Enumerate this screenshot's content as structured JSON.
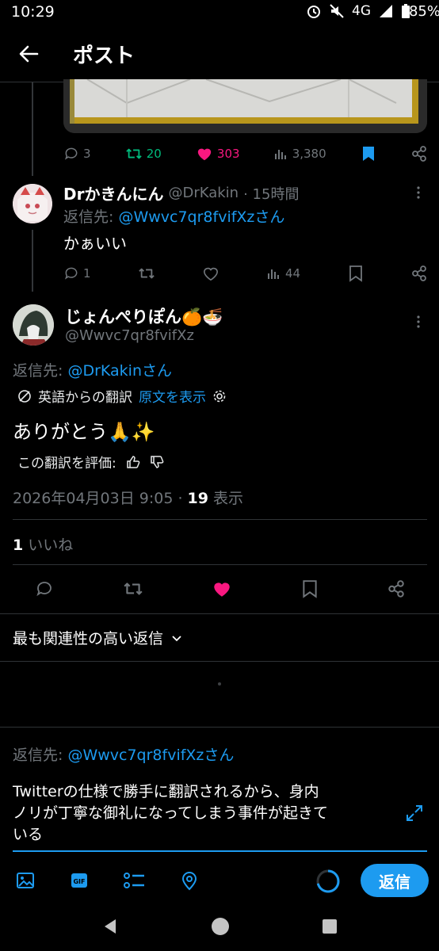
{
  "status_bar": {
    "time": "10:29",
    "network": "4G",
    "battery": "85%"
  },
  "header": {
    "title": "ポスト"
  },
  "prev_post": {
    "replies": "3",
    "retweets": "20",
    "likes": "303",
    "views": "3,380"
  },
  "reply1": {
    "display_name": "Drかきんにん",
    "handle": "@DrKakin",
    "time": "· 15時間",
    "reply_to_prefix": "返信先: ",
    "reply_to_handle": "@Wwvc7qr8fvifXzさん",
    "text": "かぁいい",
    "replies": "1",
    "views": "44"
  },
  "main_post": {
    "display_name": "じょんぺりぽん🍊🍜",
    "handle": "@Wwvc7qr8fvifXz",
    "reply_to_prefix": "返信先: ",
    "reply_to_handle": "@DrKakinさん",
    "translated_from": "英語からの翻訳",
    "show_original": "原文を表示",
    "text": "ありがとう🙏✨",
    "rate_translation": "この翻訳を評価:",
    "timestamp": "2026年04月03日 9:05 · ",
    "view_count": "19",
    "view_label": " 表示",
    "like_count": "1",
    "like_label": " いいね"
  },
  "sort": {
    "label": "最も関連性の高い返信"
  },
  "composer": {
    "reply_to_prefix": "返信先: ",
    "reply_to_handle": "@Wwvc7qr8fvifXzさん",
    "draft_line1": "Twitterの仕様で勝手に翻訳されるから、身内",
    "draft_line2": "ノリが丁寧な御礼になってしまう事件が起きて",
    "draft_line3": "いる",
    "reply_button": "返信"
  },
  "colors": {
    "accent": "#1d9bf0",
    "like": "#f91880",
    "retweet": "#00ba7c",
    "muted": "#71767b"
  }
}
